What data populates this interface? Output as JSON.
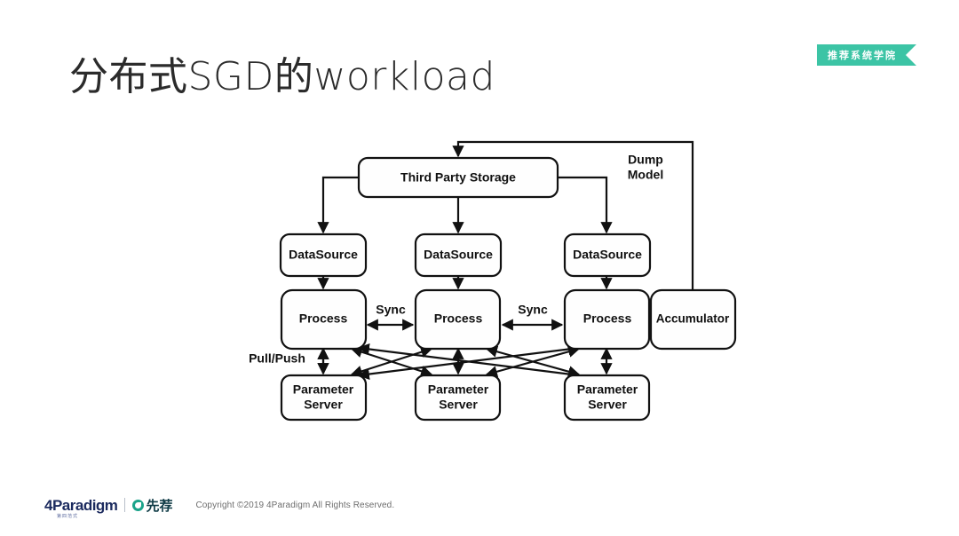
{
  "slide": {
    "title": "分布式SGD的workload",
    "badge": "推荐系统学院",
    "badge_color": "#3cc4a5"
  },
  "diagram": {
    "nodes": {
      "third_party_storage": "Third Party Storage",
      "datasource_1": "DataSource",
      "datasource_2": "DataSource",
      "datasource_3": "DataSource",
      "process_1": "Process",
      "process_2": "Process",
      "process_3": "Process",
      "accumulator": "Accumulator",
      "parameter_server_1_line1": "Parameter",
      "parameter_server_1_line2": "Server",
      "parameter_server_2_line1": "Parameter",
      "parameter_server_2_line2": "Server",
      "parameter_server_3_line1": "Parameter",
      "parameter_server_3_line2": "Server"
    },
    "edge_labels": {
      "sync_left": "Sync",
      "sync_right": "Sync",
      "pull_push": "Pull/Push",
      "dump_model_line1": "Dump",
      "dump_model_line2": "Model"
    },
    "stroke_color": "#111111",
    "fill_color": "#fefefe"
  },
  "footer": {
    "logo_primary": "4Paradigm",
    "logo_primary_sub": "第四范式",
    "logo_secondary": "先荐",
    "copyright": "Copyright ©2019 4Paradigm All Rights Reserved."
  }
}
